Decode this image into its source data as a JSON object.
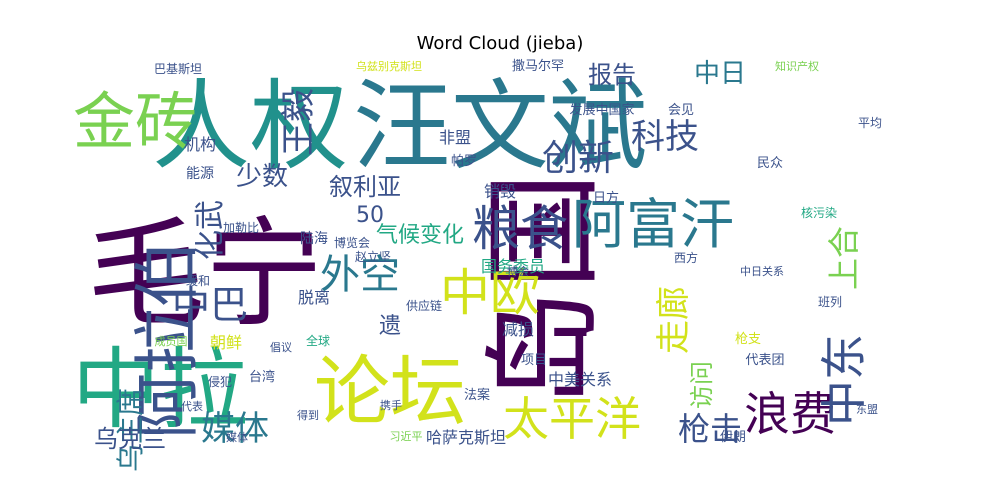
{
  "chart_data": {
    "type": "wordcloud",
    "title": "Word Cloud (jieba)",
    "colormap": [
      "#440154",
      "#3b528b",
      "#21918c",
      "#5ec962",
      "#fde725"
    ],
    "background": "#ffffff",
    "words": [
      {
        "text": "毛宁",
        "color": "#440154"
      },
      {
        "text": "岛国",
        "color": "#440154"
      },
      {
        "text": "人权",
        "color": "#21918c"
      },
      {
        "text": "汪文斌",
        "color": "#2a788e"
      },
      {
        "text": "中拉",
        "color": "#22a884"
      },
      {
        "text": "论坛",
        "color": "#d2e21b"
      },
      {
        "text": "阿拉伯",
        "color": "#3b528b"
      },
      {
        "text": "金砖",
        "color": "#7ad151"
      },
      {
        "text": "阿富汗",
        "color": "#2a788e"
      },
      {
        "text": "中欧",
        "color": "#d2e21b"
      },
      {
        "text": "粮食",
        "color": "#3b528b"
      },
      {
        "text": "太平洋",
        "color": "#d2e21b"
      },
      {
        "text": "浪费",
        "color": "#440154"
      },
      {
        "text": "中东",
        "color": "#3b528b"
      },
      {
        "text": "外空",
        "color": "#2a788e"
      },
      {
        "text": "中巴",
        "color": "#3b528b"
      },
      {
        "text": "媒体",
        "color": "#2a788e"
      },
      {
        "text": "创新",
        "color": "#3b528b"
      },
      {
        "text": "科技",
        "color": "#3b528b"
      },
      {
        "text": "王毅",
        "color": "#3b528b"
      },
      {
        "text": "走廊",
        "color": "#d2e21b"
      },
      {
        "text": "上合",
        "color": "#7ad151"
      },
      {
        "text": "枪击",
        "color": "#3b528b"
      },
      {
        "text": "乌主席",
        "color": "#2a788e"
      },
      {
        "text": "化武",
        "color": "#3b528b"
      },
      {
        "text": "叙利亚",
        "color": "#3b528b"
      },
      {
        "text": "报告",
        "color": "#3b528b"
      },
      {
        "text": "中日",
        "color": "#2a788e"
      },
      {
        "text": "气候变化",
        "color": "#22a884"
      },
      {
        "text": "少数",
        "color": "#3b528b"
      },
      {
        "text": "乌克兰",
        "color": "#3b528b"
      },
      {
        "text": "访问",
        "color": "#7ad151"
      },
      {
        "text": "遗",
        "color": "#3b528b"
      },
      {
        "text": "50",
        "color": "#3b528b"
      },
      {
        "text": "国务委员",
        "color": "#22a884"
      },
      {
        "text": "哈萨克斯坦",
        "color": "#3b528b"
      },
      {
        "text": "中美关系",
        "color": "#3b528b"
      },
      {
        "text": "机构",
        "color": "#3b528b"
      },
      {
        "text": "能源",
        "color": "#3b528b"
      },
      {
        "text": "非盟",
        "color": "#3b528b"
      },
      {
        "text": "销毁",
        "color": "#3b528b"
      },
      {
        "text": "减损",
        "color": "#3b528b"
      },
      {
        "text": "脱离",
        "color": "#3b528b"
      },
      {
        "text": "陆海",
        "color": "#3b528b"
      },
      {
        "text": "朝鲜",
        "color": "#d2e21b"
      },
      {
        "text": "发展中国家",
        "color": "#3b528b"
      },
      {
        "text": "巴基斯坦",
        "color": "#3b528b"
      },
      {
        "text": "乌兹别克斯坦",
        "color": "#d2e21b"
      },
      {
        "text": "撒马尔罕",
        "color": "#3b528b"
      },
      {
        "text": "知识产权",
        "color": "#7ad151"
      },
      {
        "text": "博览会",
        "color": "#3b528b"
      },
      {
        "text": "加勒比",
        "color": "#3b528b"
      },
      {
        "text": "赵立坚",
        "color": "#3b528b"
      },
      {
        "text": "供应链",
        "color": "#3b528b"
      },
      {
        "text": "习近平",
        "color": "#7ad151"
      },
      {
        "text": "伊朗",
        "color": "#3b528b"
      },
      {
        "text": "台湾",
        "color": "#3b528b"
      },
      {
        "text": "代表团",
        "color": "#3b528b"
      },
      {
        "text": "核污染",
        "color": "#22a884"
      },
      {
        "text": "帕罗",
        "color": "#3b528b"
      },
      {
        "text": "日方",
        "color": "#3b528b"
      },
      {
        "text": "会见",
        "color": "#3b528b"
      },
      {
        "text": "民众",
        "color": "#3b528b"
      },
      {
        "text": "平均",
        "color": "#3b528b"
      },
      {
        "text": "项目",
        "color": "#3b528b"
      },
      {
        "text": "法案",
        "color": "#3b528b"
      },
      {
        "text": "媒体",
        "color": "#3b528b"
      },
      {
        "text": "侵犯",
        "color": "#3b528b"
      },
      {
        "text": "缓和",
        "color": "#3b528b"
      },
      {
        "text": "博会",
        "color": "#3b528b"
      },
      {
        "text": "西方",
        "color": "#3b528b"
      },
      {
        "text": "中日关系",
        "color": "#3b528b"
      },
      {
        "text": "班列",
        "color": "#3b528b"
      },
      {
        "text": "枪支",
        "color": "#d2e21b"
      },
      {
        "text": "东盟",
        "color": "#3b528b"
      },
      {
        "text": "全球",
        "color": "#22a884"
      },
      {
        "text": "倡议",
        "color": "#3b528b"
      },
      {
        "text": "携手",
        "color": "#3b528b"
      },
      {
        "text": "成员国",
        "color": "#7ad151"
      },
      {
        "text": "得到",
        "color": "#3b528b"
      },
      {
        "text": "代表",
        "color": "#3b528b"
      }
    ]
  }
}
